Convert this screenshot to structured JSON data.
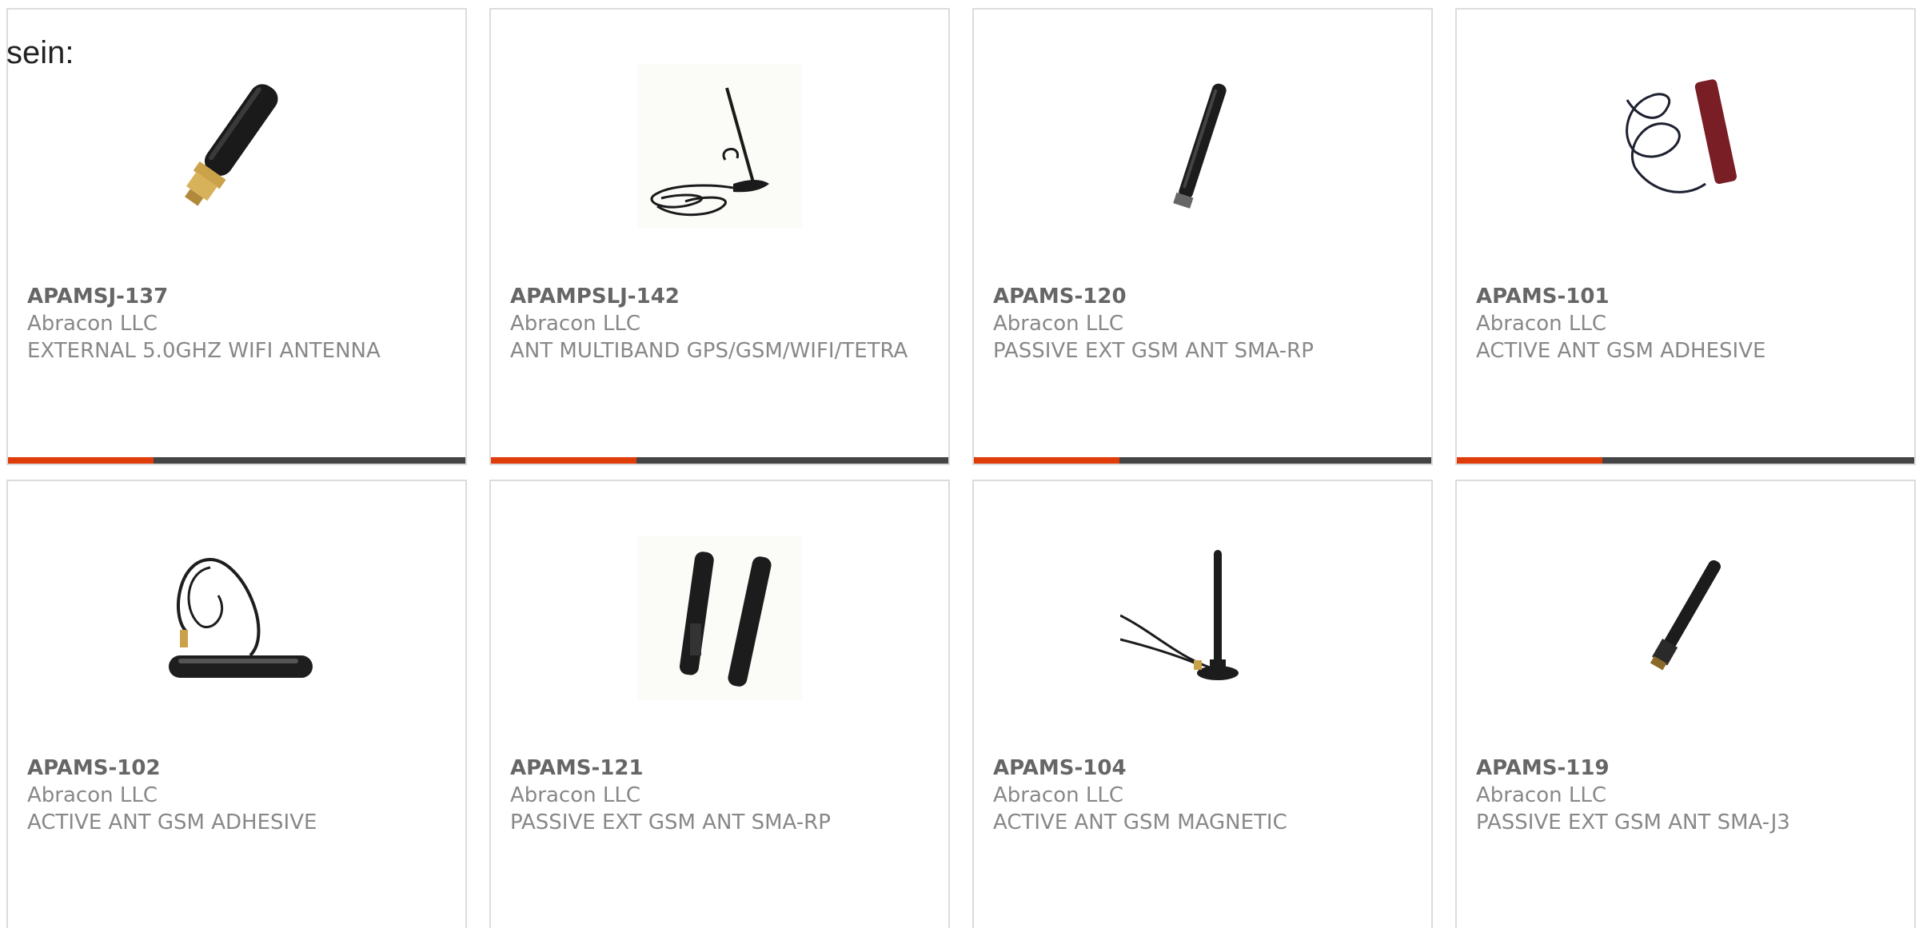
{
  "intro": "sein:",
  "colors": {
    "accent": "#e03c0a",
    "bar": "#444444"
  },
  "products": [
    {
      "part": "APAMSJ-137",
      "manufacturer": "Abracon LLC",
      "description": "EXTERNAL 5.0GHZ WIFI ANTENNA",
      "image": "stubby-sma-antenna"
    },
    {
      "part": "APAMPSLJ-142",
      "manufacturer": "Abracon LLC",
      "description": "ANT MULTIBAND GPS/GSM/WIFI/TETRA",
      "image": "magnetic-base-antenna"
    },
    {
      "part": "APAMS-120",
      "manufacturer": "Abracon LLC",
      "description": "PASSIVE EXT GSM ANT SMA-RP",
      "image": "whip-antenna"
    },
    {
      "part": "APAMS-101",
      "manufacturer": "Abracon LLC",
      "description": "ACTIVE ANT GSM ADHESIVE",
      "image": "adhesive-antenna"
    },
    {
      "part": "APAMS-102",
      "manufacturer": "Abracon LLC",
      "description": "ACTIVE ANT GSM ADHESIVE",
      "image": "flat-adhesive-antenna"
    },
    {
      "part": "APAMS-121",
      "manufacturer": "Abracon LLC",
      "description": "PASSIVE EXT GSM ANT SMA-RP",
      "image": "dual-antenna"
    },
    {
      "part": "APAMS-104",
      "manufacturer": "Abracon LLC",
      "description": "ACTIVE ANT GSM MAGNETIC",
      "image": "magnetic-whip-antenna"
    },
    {
      "part": "APAMS-119",
      "manufacturer": "Abracon LLC",
      "description": "PASSIVE EXT GSM ANT SMA-J3",
      "image": "short-whip-antenna"
    }
  ]
}
